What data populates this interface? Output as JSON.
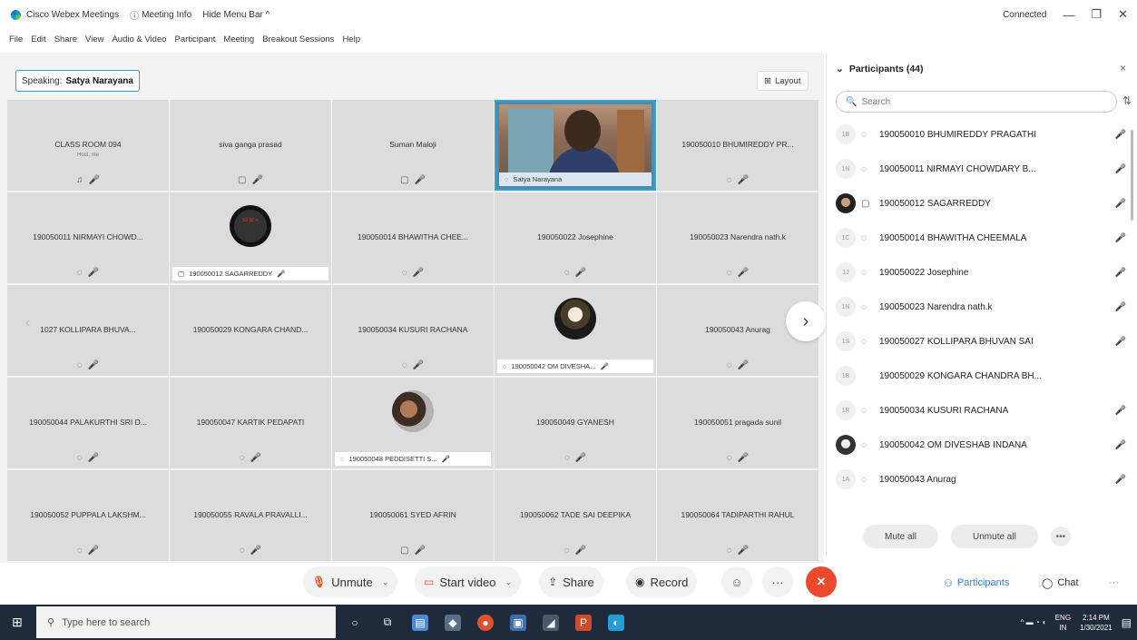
{
  "titlebar": {
    "app_name": "Cisco Webex Meetings",
    "meeting_info": "Meeting Info",
    "hide_menu": "Hide Menu Bar ^",
    "status": "Connected",
    "minimize": "—",
    "restore": "❐",
    "close": "✕"
  },
  "menu": [
    "File",
    "Edit",
    "Share",
    "View",
    "Audio & Video",
    "Participant",
    "Meeting",
    "Breakout Sessions",
    "Help"
  ],
  "stage": {
    "speaking_label": "Speaking:",
    "speaking_name": "Satya Narayana",
    "layout_label": "Layout"
  },
  "tiles": [
    {
      "name": "CLASS ROOM 094",
      "sub": "Host, me",
      "icons": [
        "♫",
        "🎤"
      ]
    },
    {
      "name": "siva ganga prasad",
      "icons": [
        "▢",
        "🎤"
      ]
    },
    {
      "name": "Suman Maloji",
      "icons": [
        "▢",
        "🎤"
      ]
    },
    {
      "name": "Satya Narayana",
      "video": true
    },
    {
      "name": "190050010 BHUMIREDDY PR...",
      "icons": [
        "◌",
        "🎤"
      ]
    },
    {
      "name": "190050011 NIRMAYI CHOWD...",
      "icons": [
        "◌",
        "🎤"
      ]
    },
    {
      "name": "190050012 SAGARREDDY",
      "avatar": "watch",
      "watch_text": "58 92 ••"
    },
    {
      "name": "190050014 BHAWITHA CHEE...",
      "icons": [
        "◌",
        "🎤"
      ]
    },
    {
      "name": "190050022 Josephine",
      "icons": [
        "◌",
        "🎤"
      ]
    },
    {
      "name": "190050023 Narendra nath.k",
      "icons": [
        "◌",
        "🎤"
      ]
    },
    {
      "name": "1027 KOLLIPARA BHUVA...",
      "icons": [
        "◌",
        "🎤"
      ]
    },
    {
      "name": "190050029 KONGARA CHAND...",
      "icons": []
    },
    {
      "name": "190050034 KUSURI RACHANA",
      "icons": [
        "◌",
        "🎤"
      ]
    },
    {
      "name": "190050042 OM DIVESHA...",
      "avatar": "photo1"
    },
    {
      "name": "190050043 Anurag",
      "icons": [
        "◌",
        "🎤"
      ]
    },
    {
      "name": "190050044 PALAKURTHI SRI D...",
      "icons": [
        "◌",
        "🎤"
      ]
    },
    {
      "name": "190050047 KARTIK PEDAPATI",
      "icons": [
        "◌",
        "🎤"
      ]
    },
    {
      "name": "190050048 PEDDISETTI S...",
      "avatar": "photo2"
    },
    {
      "name": "190050049 GYANESH",
      "icons": [
        "◌",
        "🎤"
      ]
    },
    {
      "name": "190050051 pragada sunil",
      "icons": [
        "◌",
        "🎤"
      ]
    },
    {
      "name": "190050052 PUPPALA LAKSHM...",
      "icons": [
        "◌",
        "🎤"
      ]
    },
    {
      "name": "190050055 RAVALA PRAVALLI...",
      "icons": [
        "◌",
        "🎤"
      ]
    },
    {
      "name": "190050061 SYED AFRIN",
      "icons": [
        "▢",
        "🎤"
      ]
    },
    {
      "name": "190050062 TADE SAI DEEPIKA",
      "icons": [
        "◌",
        "🎤"
      ]
    },
    {
      "name": "190050064 TADIPARTHI RAHUL",
      "icons": [
        "◌",
        "🎤"
      ]
    }
  ],
  "panel": {
    "title": "Participants (44)",
    "search_placeholder": "Search",
    "participants": [
      {
        "initials": "1B",
        "name": "190050010 BHUMIREDDY PRAGATHI",
        "icon": "◌",
        "mic": true
      },
      {
        "initials": "1N",
        "name": "190050011 NIRMAYI CHOWDARY B...",
        "icon": "◌",
        "mic": true
      },
      {
        "initials": "",
        "photo": "photo",
        "name": "190050012 SAGARREDDY",
        "icon": "▢",
        "mic": true
      },
      {
        "initials": "1C",
        "name": "190050014 BHAWITHA CHEEMALA",
        "icon": "◌",
        "mic": true
      },
      {
        "initials": "1J",
        "name": "190050022 Josephine",
        "icon": "◌",
        "mic": true
      },
      {
        "initials": "1N",
        "name": "190050023 Narendra nath.k",
        "icon": "◌",
        "mic": true
      },
      {
        "initials": "1S",
        "name": "190050027 KOLLIPARA BHUVAN SAI",
        "icon": "◌",
        "mic": true
      },
      {
        "initials": "1B",
        "name": "190050029 KONGARA CHANDRA BH...",
        "icon": "",
        "mic": false
      },
      {
        "initials": "1R",
        "name": "190050034 KUSURI RACHANA",
        "icon": "◌",
        "mic": true
      },
      {
        "initials": "",
        "photo": "photo2",
        "name": "190050042 OM DIVESHAB INDANA",
        "icon": "◌",
        "mic": true
      },
      {
        "initials": "1A",
        "name": "190050043 Anurag",
        "icon": "◌",
        "mic": true
      }
    ],
    "mute_all": "Mute all",
    "unmute_all": "Unmute all"
  },
  "controls": {
    "unmute": "Unmute",
    "start_video": "Start video",
    "share": "Share",
    "record": "Record",
    "participants": "Participants",
    "chat": "Chat"
  },
  "taskbar": {
    "search_placeholder": "Type here to search",
    "lang": "ENG",
    "region": "IN",
    "time": "2:14 PM",
    "date": "1/30/2021"
  }
}
